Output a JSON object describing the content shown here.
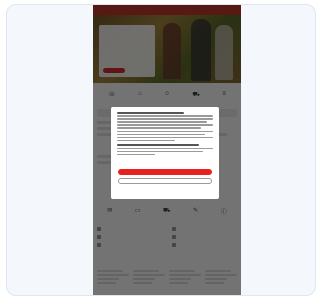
{
  "hero": {
    "title": "",
    "text": "",
    "button_label": ""
  },
  "nav_icons": [
    {
      "icon": "phone-icon",
      "glyph": "☏",
      "label": ""
    },
    {
      "icon": "store-icon",
      "glyph": "⌂",
      "label": ""
    },
    {
      "icon": "account-icon",
      "glyph": "☺",
      "label": ""
    },
    {
      "icon": "cart-icon",
      "glyph": "⛟",
      "label": ""
    },
    {
      "icon": "menu-icon",
      "glyph": "≡",
      "label": ""
    }
  ],
  "tiles": [
    {
      "icon": "mail-icon",
      "glyph": "✉",
      "label": ""
    },
    {
      "icon": "card-icon",
      "glyph": "▭",
      "label": ""
    },
    {
      "icon": "truck-icon",
      "glyph": "⛟",
      "label": ""
    },
    {
      "icon": "chat-icon",
      "glyph": "✎",
      "label": ""
    },
    {
      "icon": "info-icon",
      "glyph": "ⓘ",
      "label": ""
    }
  ],
  "cookie_modal": {
    "accept_label": "",
    "reject_label": "",
    "settings_label": "",
    "details_label": ""
  },
  "colors": {
    "brand": "#e8211f",
    "overlay": "rgba(0,0,0,0.55)"
  }
}
